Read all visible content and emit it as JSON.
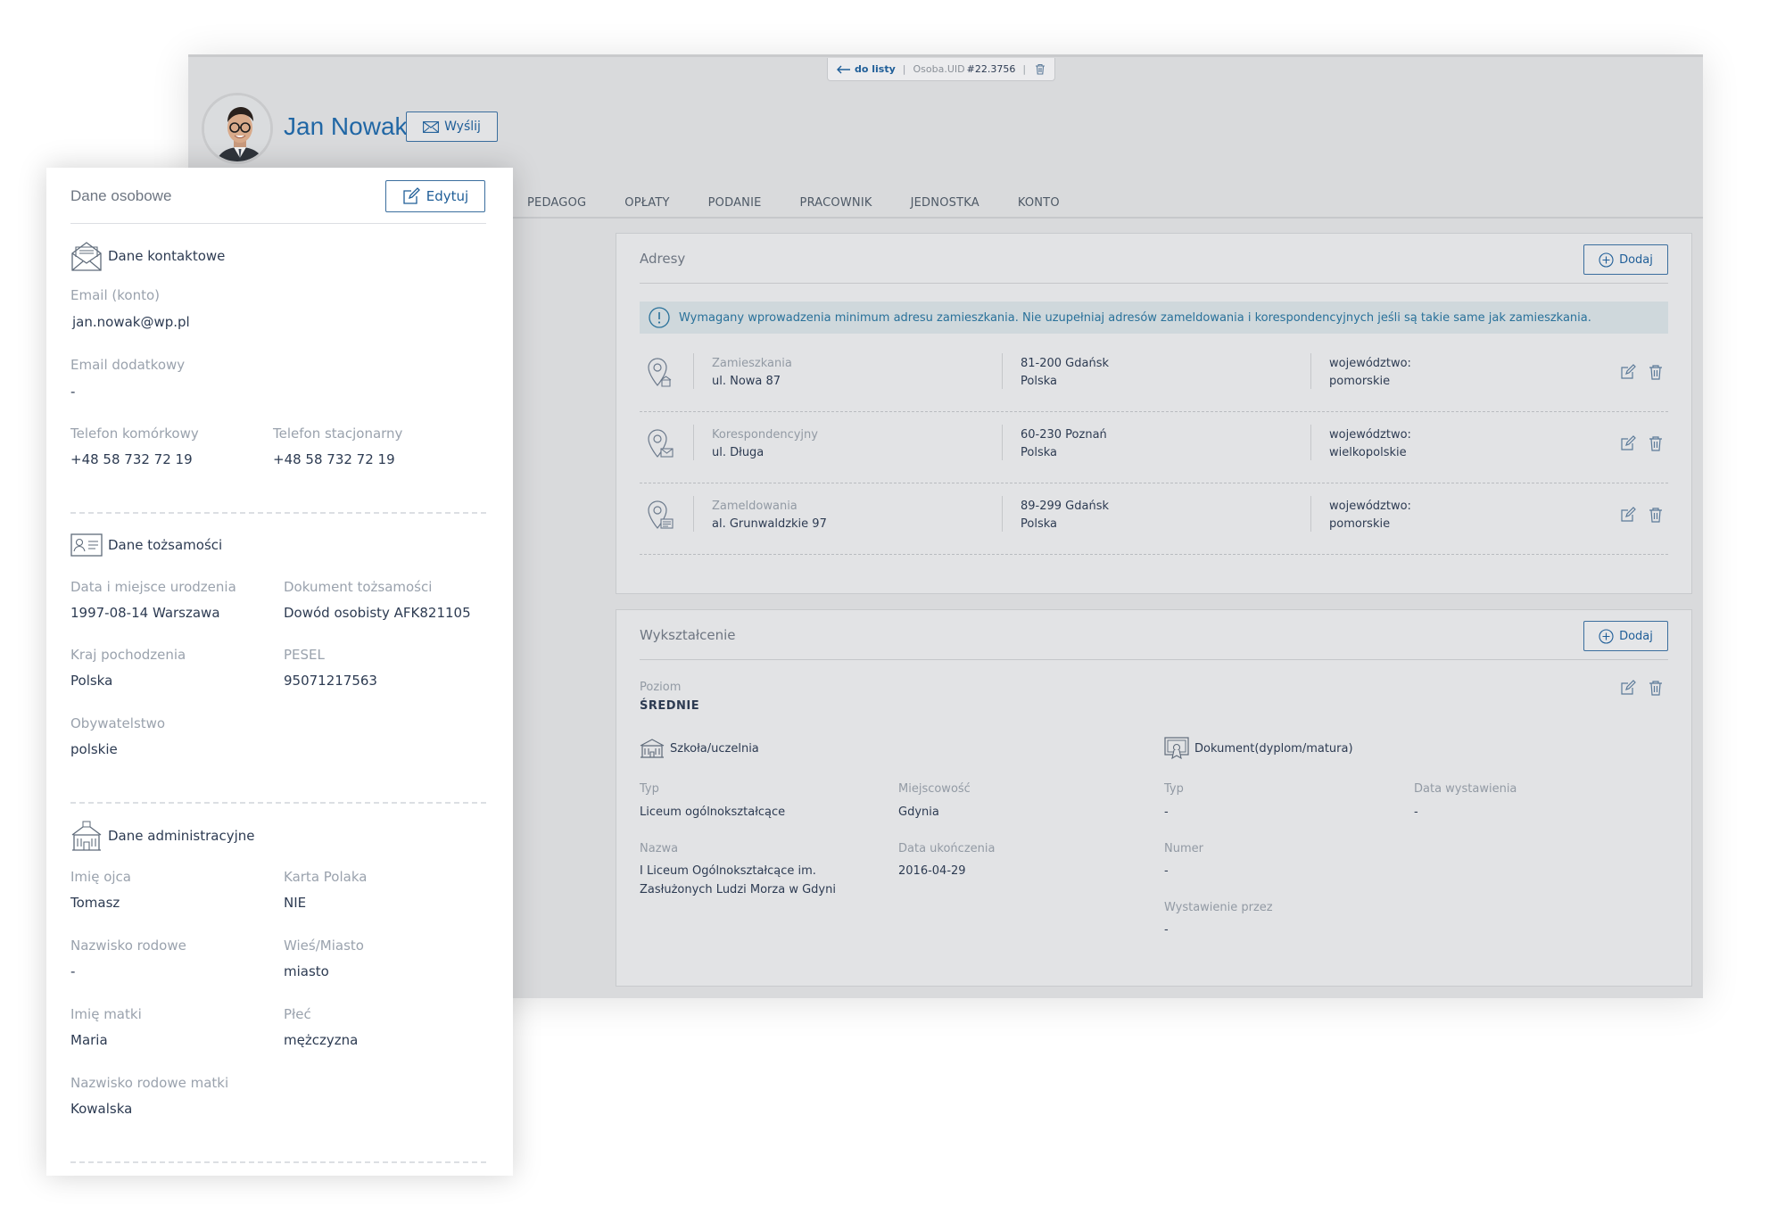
{
  "topbar": {
    "back_label": "do listy",
    "uid_label": "Osoba.UID",
    "uid_value": "#22.3756"
  },
  "person": {
    "name": "Jan Nowak",
    "send_label": "Wyślij"
  },
  "tabs": [
    "PEDAGOG",
    "OPŁATY",
    "PODANIE",
    "PRACOWNIK",
    "JEDNOSTKA",
    "KONTO"
  ],
  "addresses": {
    "title": "Adresy",
    "add_label": "Dodaj",
    "notice": "Wymagany wprowadzenia minimum adresu zamieszkania. Nie uzupełniaj adresów zameldowania i korespondencyjnych jeśli są takie same jak zamieszkania.",
    "rows": [
      {
        "type": "Zamieszkania",
        "street": "ul. Nowa 87",
        "city": "81-200 Gdańsk",
        "country": "Polska",
        "region_label": "województwo:",
        "region": "pomorskie"
      },
      {
        "type": "Korespondencyjny",
        "street": "ul. Długa",
        "city": "60-230 Poznań",
        "country": "Polska",
        "region_label": "województwo:",
        "region": "wielkopolskie"
      },
      {
        "type": "Zameldowania",
        "street": "al. Grunwaldzkie 97",
        "city": "89-299 Gdańsk",
        "country": "Polska",
        "region_label": "województwo:",
        "region": "pomorskie"
      }
    ]
  },
  "education": {
    "title": "Wykształcenie",
    "add_label": "Dodaj",
    "level_label": "Poziom",
    "level_value": "ŚREDNIE",
    "school": {
      "heading": "Szkoła/uczelnia",
      "type_label": "Typ",
      "type_value": "Liceum ogólnokształcące",
      "city_label": "Miejscowość",
      "city_value": "Gdynia",
      "name_label": "Nazwa",
      "name_line1": "I Liceum Ogólnokształcące im.",
      "name_line2": "Zasłużonych Ludzi Morza w Gdyni",
      "end_label": "Data ukończenia",
      "end_value": "2016-04-29"
    },
    "document": {
      "heading": "Dokument(dyplom/matura)",
      "type_label": "Typ",
      "type_value": "-",
      "issued_label": "Data wystawienia",
      "issued_value": "-",
      "number_label": "Numer",
      "number_value": "-",
      "issuer_label": "Wystawienie przez",
      "issuer_value": "-"
    }
  },
  "panel": {
    "title": "Dane osobowe",
    "edit_label": "Edytuj",
    "contact": {
      "heading": "Dane kontaktowe",
      "email_label": "Email (konto)",
      "email_value": "jan.nowak@wp.pl",
      "email2_label": "Email dodatkowy",
      "email2_value": "-",
      "mobile_label": "Telefon komórkowy",
      "mobile_value": "+48 58 732 72 19",
      "landline_label": "Telefon stacjonarny",
      "landline_value": "+48 58 732 72 19"
    },
    "identity": {
      "heading": "Dane tożsamości",
      "birth_label": "Data i miejsce urodzenia",
      "birth_value": "1997-08-14 Warszawa",
      "doc_label": "Dokument tożsamości",
      "doc_value": "Dowód osobisty AFK821105",
      "origin_label": "Kraj pochodzenia",
      "origin_value": "Polska",
      "pesel_label": "PESEL",
      "pesel_value": "95071217563",
      "citizenship_label": "Obywatelstwo",
      "citizenship_value": "polskie"
    },
    "admin": {
      "heading": "Dane administracyjne",
      "father_label": "Imię ojca",
      "father_value": "Tomasz",
      "card_label": "Karta Polaka",
      "card_value": "NIE",
      "maiden_label": "Nazwisko rodowe",
      "maiden_value": "-",
      "town_label": "Wieś/Miasto",
      "town_value": "miasto",
      "mother_label": "Imię matki",
      "mother_value": "Maria",
      "sex_label": "Płeć",
      "sex_value": "mężczyzna",
      "mother_maiden_label": "Nazwisko rodowe matki",
      "mother_maiden_value": "Kowalska"
    }
  }
}
